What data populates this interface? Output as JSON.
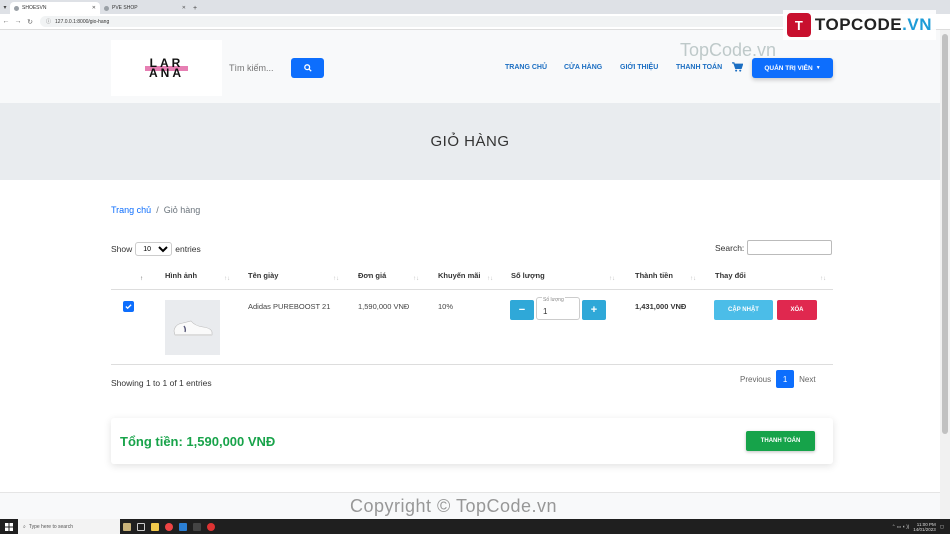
{
  "browser": {
    "tabs": [
      {
        "label": "SHOESVN",
        "active": true
      },
      {
        "label": "PVE SHOP",
        "active": false
      }
    ],
    "url": "127.0.0.1:8000/gio-hang"
  },
  "watermark": {
    "logo_text": "TOPCODE",
    "logo_suffix": ".VN",
    "site_text": "TopCode.vn",
    "copyright": "Copyright © TopCode.vn"
  },
  "header": {
    "logo_text": "LARANA",
    "search_placeholder": "Tìm kiếm...",
    "nav": [
      "TRANG CHỦ",
      "CỬA HÀNG",
      "GIỚI THIỆU",
      "THANH TOÁN"
    ],
    "admin_label": "QUẢN TRỊ VIÊN"
  },
  "hero": {
    "title": "GIỎ HÀNG"
  },
  "breadcrumb": {
    "home": "Trang chủ",
    "separator": "/",
    "current": "Giỏ hàng"
  },
  "table": {
    "show_label": "Show",
    "entries_value": "10",
    "entries_label": "entries",
    "search_label": "Search:",
    "columns": [
      "Hình ảnh",
      "Tên giày",
      "Đơn giá",
      "Khuyến mãi",
      "Số lượng",
      "Thành tiền",
      "Thay đổi"
    ],
    "rows": [
      {
        "name": "Adidas PUREBOOST 21",
        "price": "1,590,000 VNĐ",
        "discount": "10%",
        "qty_label": "Số lượng",
        "qty": "1",
        "subtotal": "1,431,000 VNĐ",
        "update_label": "CẬP NHẬT",
        "delete_label": "XÓA"
      }
    ],
    "info": "Showing 1 to 1 of 1 entries",
    "pager": {
      "prev": "Previous",
      "page": "1",
      "next": "Next"
    }
  },
  "summary": {
    "total": "Tổng tiền: 1,590,000 VNĐ",
    "checkout_label": "THANH TOÁN"
  },
  "taskbar": {
    "search": "Type here to search",
    "time": "11:00 PM",
    "date": "14/01/2023"
  },
  "colors": {
    "primary": "#0d6efd",
    "info": "#4bbde8",
    "danger": "#e0284f",
    "success": "#16a34a"
  }
}
